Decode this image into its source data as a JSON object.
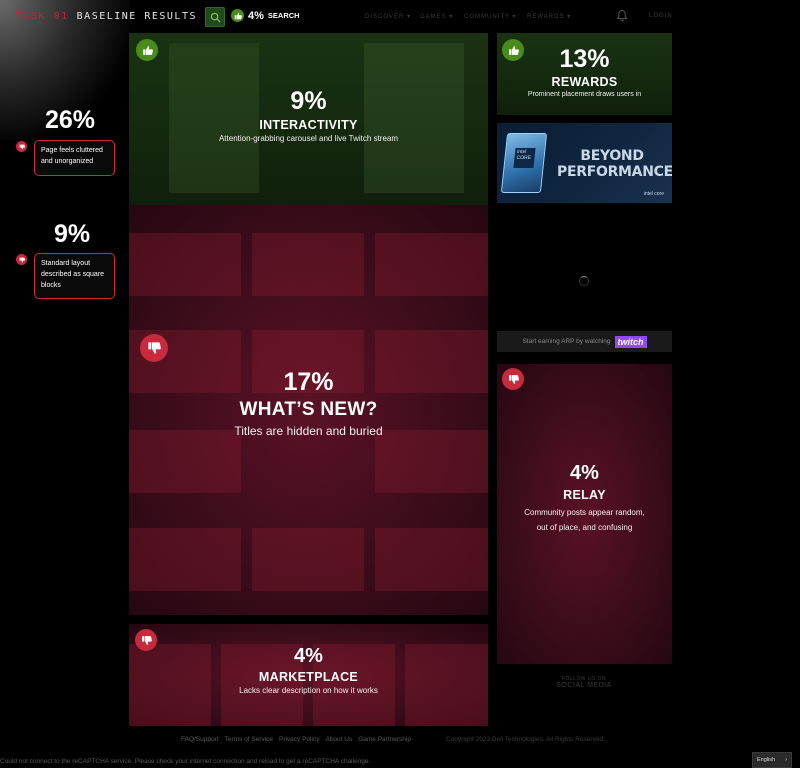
{
  "header": {
    "tag": "TASK 01",
    "title": "BASELINE RESULTS",
    "search": {
      "percent": "4%",
      "label": "SEARCH"
    },
    "nav": [
      "DISCOVER",
      "GAMES",
      "COMMUNITY",
      "REWARDS"
    ],
    "login": "LOGIN"
  },
  "left_notes": [
    {
      "percent": "26%",
      "text": "Page feels cluttered and unorganized"
    },
    {
      "percent": "9%",
      "text": "Standard layout described as square blocks"
    }
  ],
  "cards": {
    "interactivity": {
      "percent": "9%",
      "title": "INTERACTIVITY",
      "desc": "Attention-grabbing carousel and live Twitch stream"
    },
    "rewards": {
      "percent": "13%",
      "title": "REWARDS",
      "desc": "Prominent placement draws users in"
    },
    "whats_new": {
      "percent": "17%",
      "title": "WHAT’S NEW?",
      "desc": "Titles are hidden and buried"
    },
    "relay": {
      "percent": "4%",
      "title": "RELAY",
      "desc_1": "Community posts appear random,",
      "desc_2": "out of place, and confusing"
    },
    "marketplace": {
      "percent": "4%",
      "title": "MARKETPLACE",
      "desc": "Lacks clear description on how it works"
    }
  },
  "ad": {
    "chip_text": "intel CORE",
    "headline_1": "BEYOND",
    "headline_2": "PERFORMANCE",
    "brand": "intel core"
  },
  "twitch": {
    "text": "Start earning ARP by watching",
    "logo": "twitch"
  },
  "social": {
    "line1": "FOLLOW US ON",
    "line2": "SOCIAL MEDIA"
  },
  "footer": {
    "links": [
      "FAQ/Support",
      "Terms of Service",
      "Privacy Policy",
      "About Us",
      "Game Partnership"
    ],
    "copyright": "Copyright 2023 Dell Technologies. All Rights Reserved."
  },
  "captcha": "Could not connect to the reCAPTCHA service. Please check your internet connection and reload to get a reCAPTCHA challenge.",
  "language": "English",
  "colors": {
    "positive": "#4a8c1c",
    "negative": "#c62a3c",
    "accent_red": "#d2283a"
  },
  "icons": [
    "search-icon",
    "thumbs-up-icon",
    "thumbs-down-icon",
    "bell-icon",
    "chevron-right-icon"
  ]
}
